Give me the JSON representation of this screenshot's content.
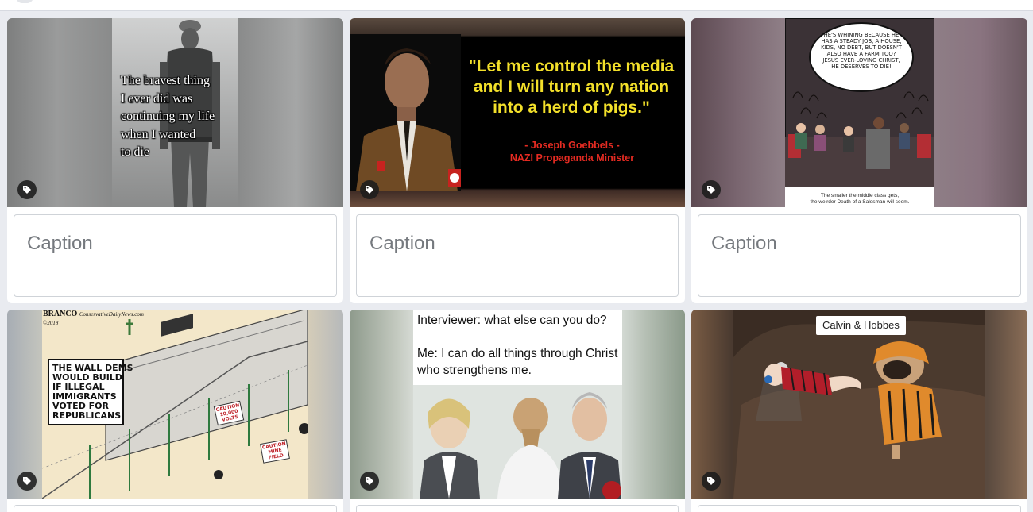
{
  "cards": [
    {
      "caption_placeholder": "Caption",
      "tag_icon": "tag-icon",
      "meme_text": "The bravest thing\nI ever did was\ncontinuing my life\nwhen I wanted\nto die"
    },
    {
      "caption_placeholder": "Caption",
      "tag_icon": "tag-icon",
      "quote": "\"Let me control the media and I will turn any nation into a herd of pigs.\"",
      "attribution": "- Joseph Goebbels -",
      "attribution_role": "NAZI Propaganda Minister"
    },
    {
      "caption_placeholder": "Caption",
      "tag_icon": "tag-icon",
      "bubble_text": "HE'S WHINING BECAUSE HE HAS A STEADY JOB, A HOUSE, KIDS, NO DEBT, BUT DOESN'T ALSO HAVE A FARM TOO? JESUS EVER-LOVING CHRIST, HE DESERVES TO DIE!",
      "bottom_caption_1": "The smaller the middle class gets,",
      "bottom_caption_2": "the weirder Death of a Salesman will seem."
    },
    {
      "tag_icon": "tag-icon",
      "brand": "BRANCO",
      "brand_site": "ConservativeDailyNews.com",
      "brand_year": "©2018",
      "sign_text": "THE WALL DEMS\nWOULD BUILD\nIF ILLEGAL\nIMMIGRANTS\nVOTED FOR\nREPUBLICANS",
      "caution_1": "CAUTION\n10,000\nVOLTS",
      "caution_2": "CAUTION\nMINE\nFIELD"
    },
    {
      "tag_icon": "tag-icon",
      "meme_text": "Interviewer: what else can you do?\n\nMe: I can do all things through Christ\nwho strengthens me."
    },
    {
      "tag_icon": "tag-icon",
      "label": "Calvin & Hobbes"
    }
  ],
  "colors": {
    "background": "#e9ebf0",
    "card": "#ffffff",
    "caption_border": "#cfd3d8",
    "caption_placeholder": "#75797e",
    "tag_button": "#1c1c1c"
  }
}
